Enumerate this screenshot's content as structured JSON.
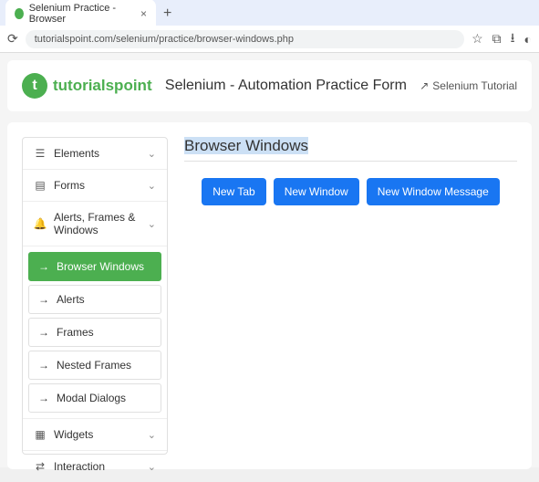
{
  "browser": {
    "tab_title": "Selenium Practice - Browser",
    "url": "tutorialspoint.com/selenium/practice/browser-windows.php"
  },
  "header": {
    "logo_text": "tutorialspoint",
    "title": "Selenium - Automation Practice Form",
    "tutorial_link": "Selenium Tutorial"
  },
  "sidebar": {
    "elements_label": "Elements",
    "forms_label": "Forms",
    "alerts_label": "Alerts, Frames & Windows",
    "widgets_label": "Widgets",
    "interaction_label": "Interaction",
    "sub": {
      "browser_windows": "Browser Windows",
      "alerts": "Alerts",
      "frames": "Frames",
      "nested_frames": "Nested Frames",
      "modal_dialogs": "Modal Dialogs"
    }
  },
  "main": {
    "title": "Browser Windows",
    "buttons": {
      "new_tab": "New Tab",
      "new_window": "New Window",
      "new_window_msg": "New Window Message"
    }
  }
}
